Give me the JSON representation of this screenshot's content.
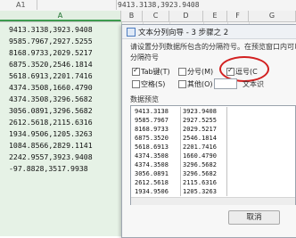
{
  "formula_bar": {
    "cell_ref": "A1",
    "content": "9413.3138,3923.9408"
  },
  "columns": [
    "A",
    "B",
    "C",
    "D",
    "E",
    "F",
    "G"
  ],
  "column_a_rows": [
    "9413.3138,3923.9408",
    "9585.7967,2927.5255",
    "8168.9733,2029.5217",
    "6875.3520,2546.1814",
    "5618.6913,2201.7416",
    "4374.3508,1660.4790",
    "4374.3508,3296.5682",
    "3056.0891,3296.5682",
    "2612.5618,2115.6316",
    "1934.9506,1205.3263",
    "1084.8566,2829.1141",
    "2242.9557,3923.9408",
    "-97.8828,3517.9938"
  ],
  "dialog": {
    "title": "文本分列向导 - 3 步骤之 2",
    "intro": "请设置分列数据所包含的分隔符号。在预览窗口内可以看到",
    "group_label": "分隔符号",
    "options": {
      "tab": "Tab键(T)",
      "semicolon": "分号(M)",
      "comma": "逗号(C",
      "space": "空格(S)",
      "other": "其他(O)",
      "qualifier": "文本识"
    },
    "checked": {
      "tab": true,
      "semicolon": false,
      "comma": true,
      "space": false,
      "other": false
    },
    "preview_label": "数据预览",
    "preview_rows": [
      [
        "9413.3138",
        "3923.9408",
        ""
      ],
      [
        "9585.7967",
        "2927.5255",
        ""
      ],
      [
        "8168.9733",
        "2029.5217",
        ""
      ],
      [
        "6875.3520",
        "2546.1814",
        ""
      ],
      [
        "5618.6913",
        "2201.7416",
        ""
      ],
      [
        "4374.3508",
        "1660.4790",
        ""
      ],
      [
        "4374.3508",
        "3296.5682",
        ""
      ],
      [
        "3056.0891",
        "3296.5682",
        ""
      ],
      [
        "2612.5618",
        "2115.6316",
        ""
      ],
      [
        "1934.9506",
        "1205.3263",
        ""
      ]
    ],
    "cancel_label": "取消"
  },
  "colors": {
    "selected_column": "#e6f2e6",
    "selection_accent": "#3d9b4f",
    "annotation_circle": "#d22020"
  }
}
